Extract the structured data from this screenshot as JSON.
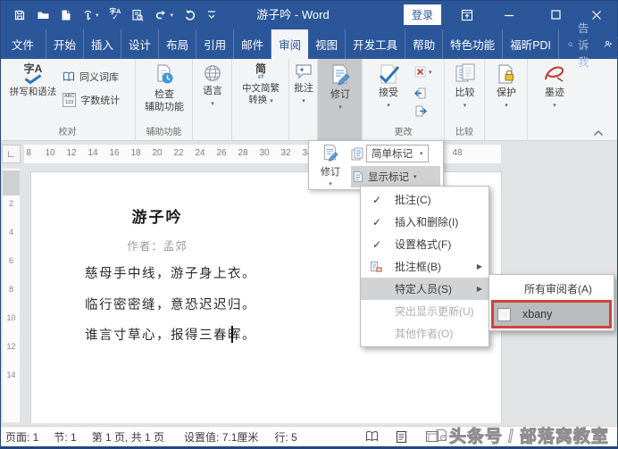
{
  "window": {
    "title": "游子吟 - Word",
    "sign_in": "登录"
  },
  "tabs": [
    {
      "label": "文件"
    },
    {
      "label": "开始"
    },
    {
      "label": "插入"
    },
    {
      "label": "设计"
    },
    {
      "label": "布局"
    },
    {
      "label": "引用"
    },
    {
      "label": "邮件"
    },
    {
      "label": "审阅"
    },
    {
      "label": "视图"
    },
    {
      "label": "开发工具"
    },
    {
      "label": "帮助"
    },
    {
      "label": "特色功能"
    },
    {
      "label": "福昕PDI"
    }
  ],
  "tab_extras": {
    "tell_me": "告诉我",
    "share": "共享"
  },
  "ribbon": {
    "proofing": {
      "spelling": "拼写和语法",
      "spelling_icon_text": "字A",
      "thesaurus": "同义词库",
      "word_count": "字数统计",
      "abc": "ABC",
      "nums": "123",
      "group": "校对"
    },
    "accessibility": {
      "line1": "检查",
      "line2": "辅助功能",
      "group": "辅助功能"
    },
    "language": {
      "label": "语言"
    },
    "convert": {
      "icon_char": "简",
      "line1": "中文简繁",
      "line2": "转换"
    },
    "comments": {
      "label": "批注"
    },
    "track": {
      "label": "修订"
    },
    "changes": {
      "accept": "接受",
      "group": "更改"
    },
    "compare": {
      "label": "比较",
      "group": "比较"
    },
    "protect": {
      "label": "保护"
    },
    "ink": {
      "label": "墨迹"
    }
  },
  "flyout": {
    "track": "修订",
    "simple_markup": "简单标记",
    "show_markup": "显示标记"
  },
  "menu": {
    "items": [
      {
        "label": "批注(C)",
        "checked": true
      },
      {
        "label": "插入和删除(I)",
        "checked": true
      },
      {
        "label": "设置格式(F)",
        "checked": true
      },
      {
        "label": "批注框(B)"
      },
      {
        "label": "特定人员(S)",
        "highlighted": true
      },
      {
        "label": "突出显示更新(U)",
        "disabled": true
      },
      {
        "label": "其他作者(O)",
        "disabled": true
      }
    ]
  },
  "submenu": {
    "all_reviewers": "所有审阅者(A)",
    "reviewer": "xbany"
  },
  "ruler": {
    "h": [
      "8",
      "10",
      "12",
      "14",
      "16",
      "18",
      "20",
      "22",
      "24",
      "26",
      "28",
      "30",
      "32",
      "34",
      "48"
    ],
    "v": [
      "2",
      "4",
      "6",
      "8",
      "10",
      "12",
      "14"
    ]
  },
  "doc": {
    "title": "游子吟",
    "author": "作者：孟郊",
    "lines": [
      "慈母手中线，游子身上衣。",
      "临行密密缝，意恐迟迟归。",
      "谁言寸草心，报得三春晖。"
    ]
  },
  "status": {
    "page": "页面: 1",
    "section": "节: 1",
    "page_of": "第 1 页, 共 1 页",
    "setting": "设置值: 7.1厘米",
    "line": "行: 5"
  },
  "watermark": "头条号 / 部落窝教室",
  "glyphs": {
    "check": "✓",
    "arrow_right": "▶",
    "caret_down": "▾",
    "tab_stop": "∟",
    "reject_x": "✗"
  },
  "colors": {
    "accent": "#2b579a",
    "annotation_red": "#d2423a",
    "menu_highlight": "#d2d3d4",
    "pressed": "#c7c8ca"
  }
}
